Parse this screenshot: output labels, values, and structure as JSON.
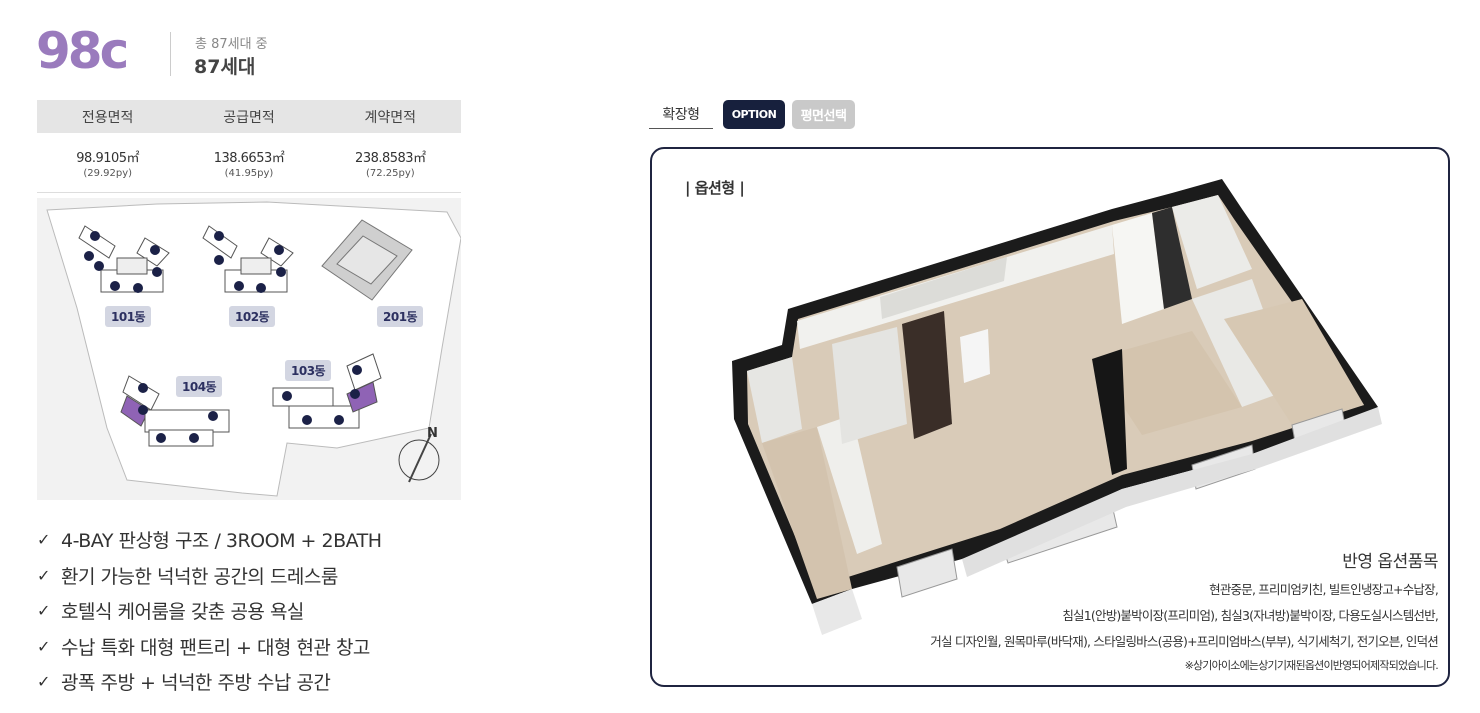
{
  "header": {
    "type": "98c",
    "units_total": "총 87세대 중",
    "units_count": "87세대"
  },
  "area_table": {
    "headers": [
      "전용면적",
      "공급면적",
      "계약면적"
    ],
    "values": [
      {
        "area": "98.9105㎡",
        "py": "(29.92py)"
      },
      {
        "area": "138.6653㎡",
        "py": "(41.95py)"
      },
      {
        "area": "238.8583㎡",
        "py": "(72.25py)"
      }
    ]
  },
  "site_plan": {
    "dong_labels": [
      "101동",
      "102동",
      "201동",
      "104동",
      "103동"
    ],
    "north_label": "N",
    "highlight_color": "#8f63b5"
  },
  "features": [
    "4-BAY 판상형 구조 / 3ROOM + 2BATH",
    "환기 가능한 넉넉한 공간의 드레스룸",
    "호텔식 케어룸을 갖춘 공용 욕실",
    "수납 특화 대형 팬트리 + 대형 현관 창고",
    "광폭 주방 + 넉넉한 주방 수납 공간"
  ],
  "check_mark": "✓",
  "tabs": {
    "expand": "확장형",
    "option": "OPTION",
    "select": "평면선택"
  },
  "plan": {
    "title": "| 옵션형 |",
    "options_title": "반영 옵션품목",
    "options_lines": [
      "현관중문, 프리미엄키친, 빌트인냉장고+수납장,",
      "침실1(안방)붙박이장(프리미엄), 침실3(자녀방)붙박이장, 다용도실시스템선반,",
      "거실 디자인월, 원목마루(바닥재), 스타일링바스(공용)+프리미엄바스(부부), 식기세척기, 전기오븐, 인덕션"
    ],
    "note": "※상기아이소에는상기기재된옵션이반영되어제작되었습니다."
  },
  "colors": {
    "accent_purple": "#9a7bbd",
    "navy": "#17203d",
    "tab_gray": "#c9c9c9",
    "dong_badge": "#d3d6e2"
  }
}
